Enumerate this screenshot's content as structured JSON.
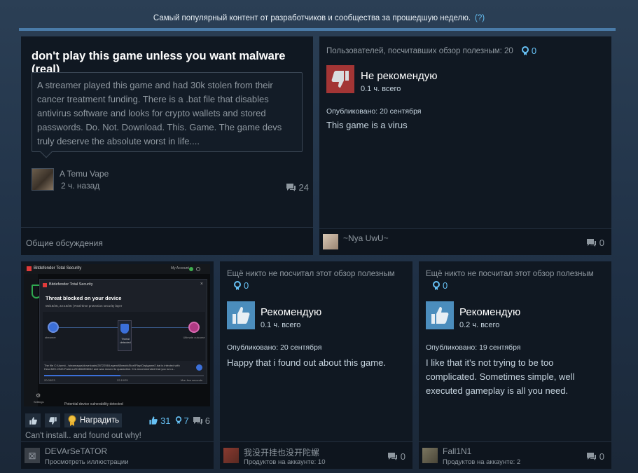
{
  "header": {
    "text": "Самый популярный контент от разработчиков и сообщества за прошедшую неделю.",
    "help": "(?)"
  },
  "discussion": {
    "title": "don't play this game unless you want malware (real)",
    "body": "A streamer played this game and had 30k stolen from their cancer treatment funding. There is a .bat file that disables antivirus software and looks for crypto wallets and stored passwords. Do. Not. Download. This. Game. The game devs truly deserve the absolute worst in life....",
    "author": "A Temu Vape",
    "time": "2 ч. назад",
    "comments": "24",
    "forum": "Общие обсуждения"
  },
  "review1": {
    "helpful": "Пользователей, посчитавших обзор полезным: 20",
    "awards": "0",
    "verdict": "Не рекомендую",
    "hours": "0.1 ч. всего",
    "posted": "Опубликовано: 20 сентября",
    "text": "This game is a virus",
    "author": "~Nya UwU~",
    "comments": "0"
  },
  "screenshot": {
    "app": "Bitdefender Total Security",
    "popup": "Bitdefender Total Security",
    "threat": "Threat blocked on your device",
    "meta": "05/16/25, 22:10/25 | Real-time protection security layer",
    "node1": "streamer",
    "node2": "Threat detected",
    "node3": "Ultimate outcome",
    "details": "The file C:\\Users\\...\\steamapps\\downloads\\2872256\\Legend\\Beasts\\Storl\\Play\\Ozg\\game2.bat is infected with Heur.BZC.ONG.Parlera.201652896042 and was moved to quarantine. It is recommended that you run a...",
    "time1": "20:05/23",
    "time2": "22:10/25",
    "time3": "Mon few seconds",
    "settings": "Settings",
    "note": "Potential device vulnerability detected",
    "account": "My Account",
    "award_btn": "Наградить",
    "thumbs_up": "31",
    "awards": "7",
    "comments": "6",
    "caption": "Can't install.. and found out why!",
    "author": "DEVArSeTATOR",
    "view": "Просмотреть иллюстрации"
  },
  "review2": {
    "helpful": "Ещё никто не посчитал этот обзор полезным",
    "awards": "0",
    "verdict": "Рекомендую",
    "hours": "0.1 ч. всего",
    "posted": "Опубликовано: 20 сентября",
    "text": "Happy that i found out about this game.",
    "author": "我没开挂也没开陀螺",
    "products": "Продуктов на аккаунте: 10",
    "comments": "0"
  },
  "review3": {
    "helpful": "Ещё никто не посчитал этот обзор полезным",
    "awards": "0",
    "verdict": "Рекомендую",
    "hours": "0.2 ч. всего",
    "posted": "Опубликовано: 19 сентября",
    "text": "I like that it's not trying to be too complicated. Sometimes simple, well executed gameplay is all you need.",
    "author": "Fall1N1",
    "products": "Продуктов на аккаунте: 2",
    "comments": "0"
  },
  "colors": {
    "accent": "#66c0f4",
    "thumb_up": "#4b8dbd",
    "thumb_down": "#a33535"
  }
}
